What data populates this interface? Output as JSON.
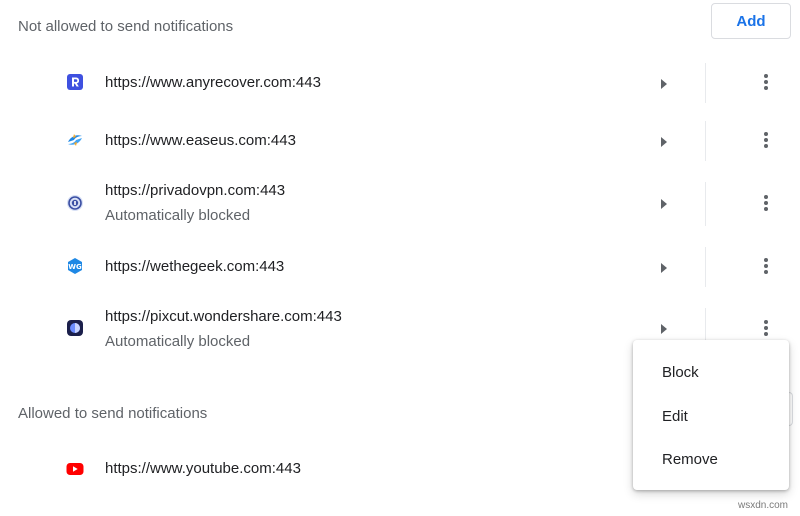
{
  "blocked_section": {
    "title": "Not allowed to send notifications",
    "add_label": "Add",
    "sites": [
      {
        "url": "https://www.anyrecover.com:443",
        "sub": ""
      },
      {
        "url": "https://www.easeus.com:443",
        "sub": ""
      },
      {
        "url": "https://privadovpn.com:443",
        "sub": "Automatically blocked"
      },
      {
        "url": "https://wethegeek.com:443",
        "sub": ""
      },
      {
        "url": "https://pixcut.wondershare.com:443",
        "sub": "Automatically blocked"
      }
    ]
  },
  "allowed_section": {
    "title": "Allowed to send notifications",
    "sites": [
      {
        "url": "https://www.youtube.com:443",
        "sub": ""
      }
    ]
  },
  "context_menu": {
    "items": [
      "Block",
      "Edit",
      "Remove"
    ]
  },
  "watermark": "wsxdn.com",
  "colors": {
    "accent": "#1a73e8",
    "text": "#202124",
    "secondary_text": "#5f6368",
    "icon": "#5f6368"
  }
}
